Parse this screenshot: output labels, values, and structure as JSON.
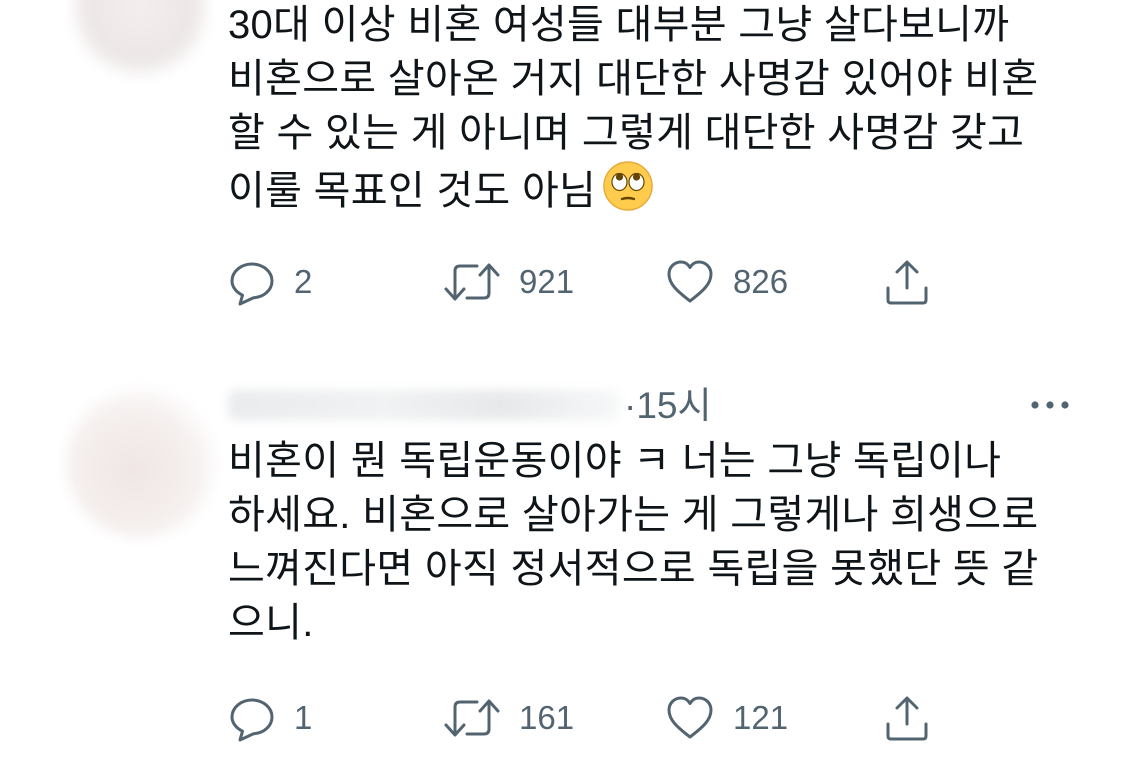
{
  "tweets": [
    {
      "text": "30대 이상 비혼 여성들 대부분 그냥 살다보니까\n비혼으로 살아온 거지 대단한 사명감 있어야 비혼\n할 수 있는 게 아니며 그렇게 대단한 사명감 갖고\n이룰 목표인 것도 아님",
      "emoji": "face-with-rolling-eyes",
      "replies": "2",
      "retweets": "921",
      "likes": "826"
    },
    {
      "time": "·15시",
      "text": "비혼이 뭔 독립운동이야 ㅋ 너는 그냥 독립이나\n하세요. 비혼으로 살아가는 게 그렇게나 희생으로\n느껴진다면 아직 정서적으로 독립을 못했단 뜻 같\n으니.",
      "replies": "1",
      "retweets": "161",
      "likes": "121"
    }
  ],
  "colors": {
    "text": "#0f1419",
    "secondary": "#536471"
  }
}
